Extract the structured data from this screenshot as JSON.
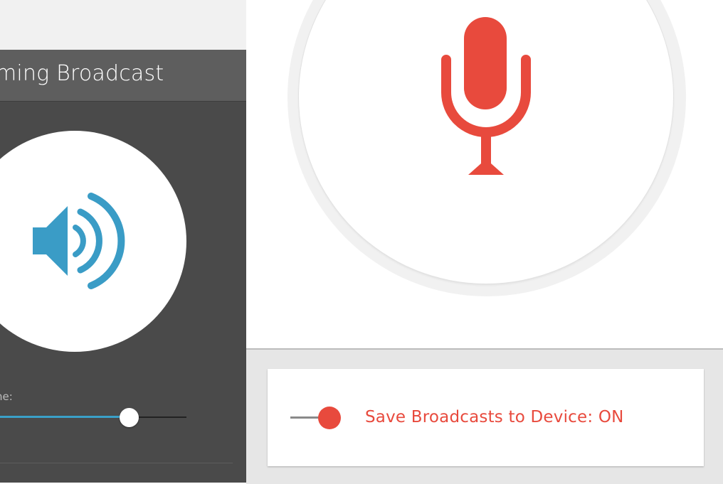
{
  "broadcast_panel": {
    "title": "ming Broadcast",
    "volume_label": "ne:",
    "volume_level": 0.69
  },
  "icons": {
    "speaker": "speaker-volume-icon",
    "mic": "microphone-icon"
  },
  "save_setting": {
    "label": "Save Broadcasts to Device: ON",
    "enabled": true
  },
  "colors": {
    "accent_red": "#e84a3d",
    "accent_blue": "#3aa0c8",
    "panel_dark": "#4a4a4a",
    "titlebar": "#5e5e5e"
  }
}
